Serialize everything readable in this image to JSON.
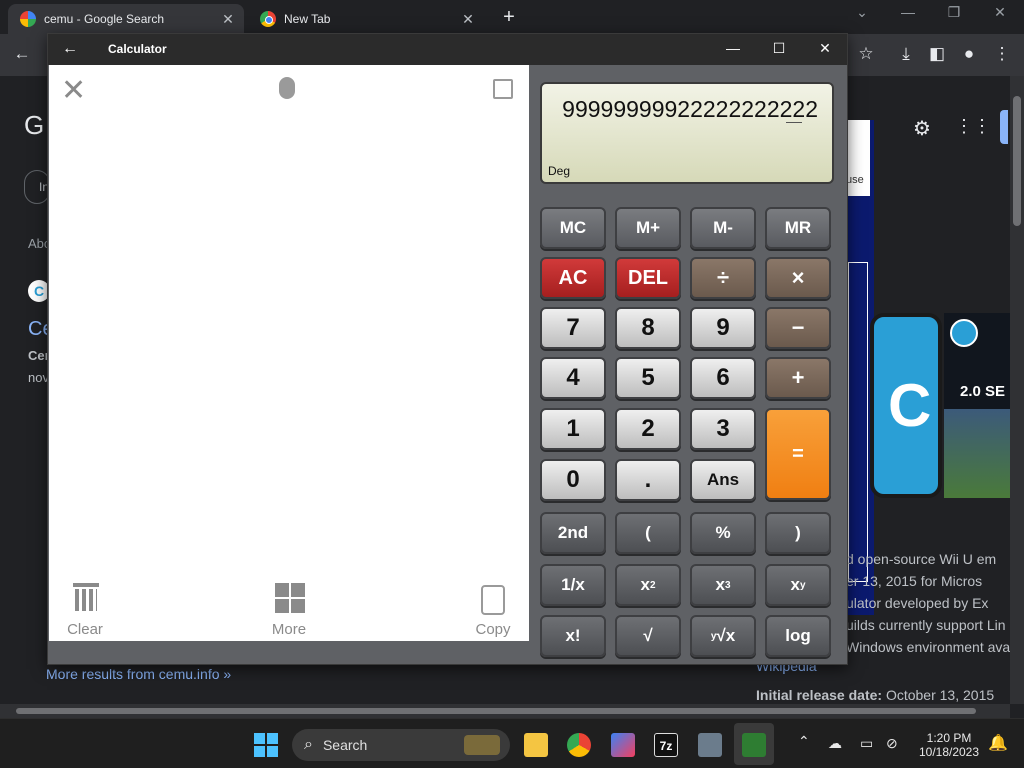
{
  "browser": {
    "tabs": [
      {
        "title": "cemu - Google Search",
        "icon": "google-icon"
      },
      {
        "title": "New Tab",
        "icon": "chrome-icon"
      }
    ],
    "new_tab": "+",
    "window_controls": {
      "dropdown": "⌄",
      "minimize": "—",
      "restore": "❐",
      "close": "✕"
    }
  },
  "page": {
    "search_initial": "G",
    "filter_chip": "In",
    "about": "Abo",
    "result_icon_letter": "C",
    "result_title": "Ce",
    "snippet_1": "Cer",
    "snippet_2": "nov",
    "more_results": "More results from cemu.info »",
    "panel_lines": [
      "d open-source Wii U em",
      "er 13, 2015 for Micros",
      "ulator developed by Ex",
      "uilds currently support Lin",
      "Windows environment ava"
    ],
    "wikipedia": "Wikipedia",
    "release_label": "Initial release date:",
    "release_value": "October 13, 2015",
    "panel_tab": "use",
    "right_badge": "2.0 SE",
    "right_letter": "C"
  },
  "calculator": {
    "title": "Calculator",
    "history": {
      "clear_label": "Clear",
      "more_label": "More",
      "copy_label": "Copy"
    },
    "display": {
      "value": "99999999922222222222",
      "mode": "Deg"
    },
    "keys": {
      "mc": "MC",
      "mplus": "M+",
      "mminus": "M-",
      "mr": "MR",
      "ac": "AC",
      "del": "DEL",
      "divide": "÷",
      "multiply": "×",
      "n7": "7",
      "n8": "8",
      "n9": "9",
      "minus": "−",
      "n4": "4",
      "n5": "5",
      "n6": "6",
      "plus": "+",
      "n1": "1",
      "n2": "2",
      "n3": "3",
      "equals": "=",
      "n0": "0",
      "dot": ".",
      "ans": "Ans",
      "second": "2nd",
      "lparen": "(",
      "percent": "%",
      "rparen": ")",
      "reciprocal": "1/x",
      "square_base": "x",
      "square_exp": "2",
      "cube_base": "x",
      "cube_exp": "3",
      "power_base": "x",
      "power_exp": "y",
      "factorial": "x!",
      "sqrt": "√",
      "root_idx": "y",
      "root_sym": "√x",
      "log": "log"
    }
  },
  "taskbar": {
    "search_placeholder": "Search",
    "time": "1:20 PM",
    "date": "10/18/2023",
    "app_7z_label": "7z"
  }
}
